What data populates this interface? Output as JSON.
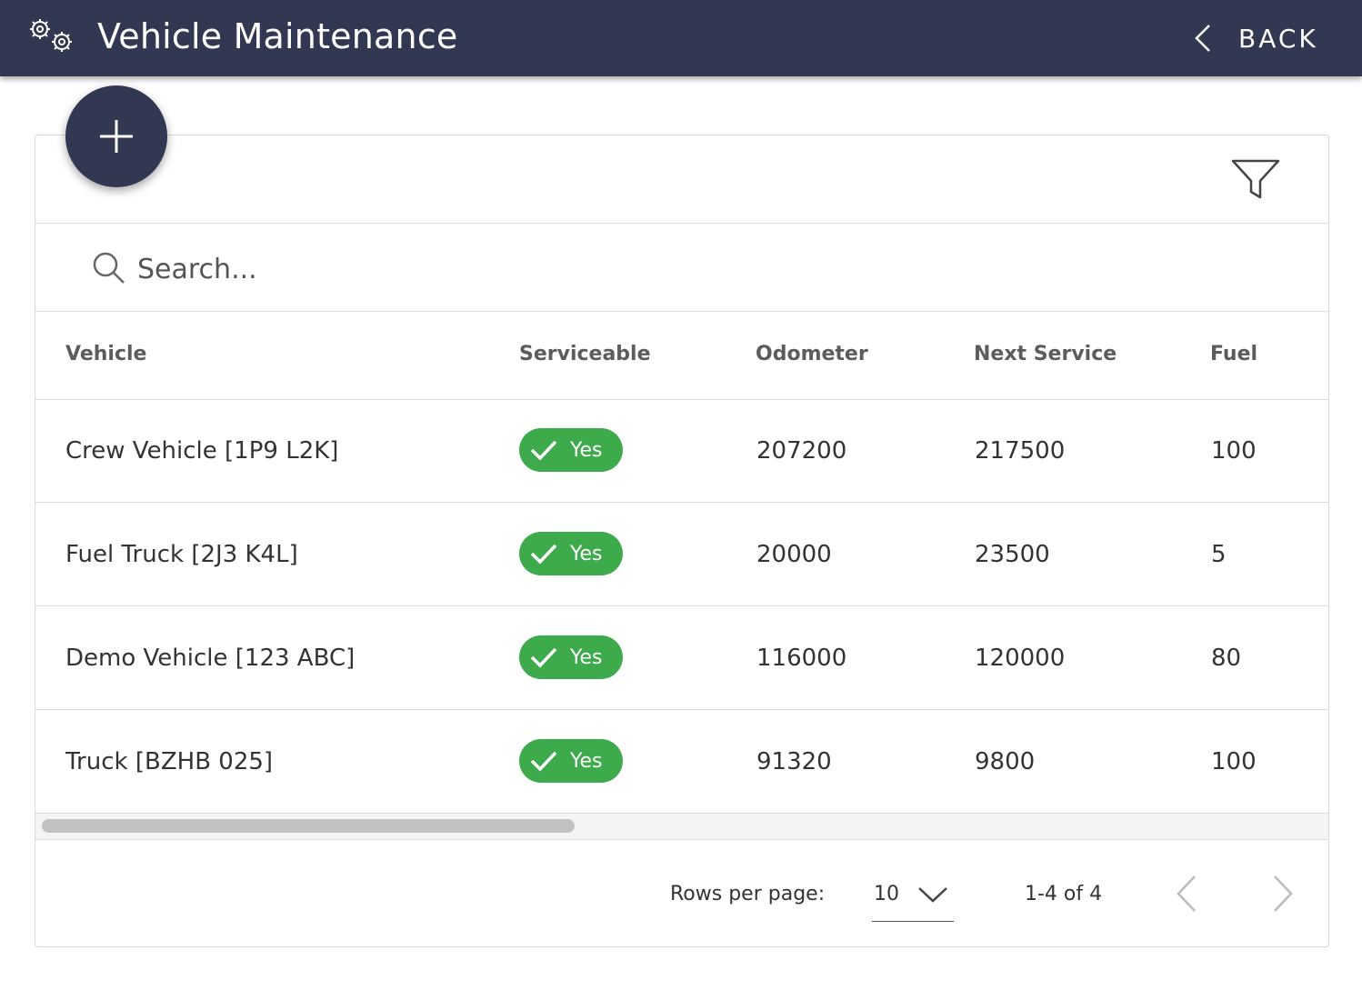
{
  "header": {
    "title": "Vehicle Maintenance",
    "back_label": "BACK",
    "icon": "gears-icon",
    "background": "#323752"
  },
  "fab": {
    "icon": "plus-icon"
  },
  "toolbar": {
    "filter_icon": "filter-icon"
  },
  "search": {
    "placeholder": "Search...",
    "value": ""
  },
  "table": {
    "columns": [
      "Vehicle",
      "Serviceable",
      "Odometer",
      "Next Service",
      "Fuel"
    ],
    "rows": [
      {
        "vehicle": "Crew Vehicle [1P9 L2K]",
        "serviceable": "Yes",
        "odometer": "207200",
        "next_service": "217500",
        "fuel": "100"
      },
      {
        "vehicle": "Fuel Truck [2J3 K4L]",
        "serviceable": "Yes",
        "odometer": "20000",
        "next_service": "23500",
        "fuel": "5"
      },
      {
        "vehicle": "Demo Vehicle [123 ABC]",
        "serviceable": "Yes",
        "odometer": "116000",
        "next_service": "120000",
        "fuel": "80"
      },
      {
        "vehicle": "Truck [BZHB 025]",
        "serviceable": "Yes",
        "odometer": "91320",
        "next_service": "9800",
        "fuel": "100"
      }
    ],
    "badge_color": "#3daa4c"
  },
  "pagination": {
    "rows_per_page_label": "Rows per page:",
    "rows_per_page": "10",
    "range": "1-4 of 4"
  }
}
